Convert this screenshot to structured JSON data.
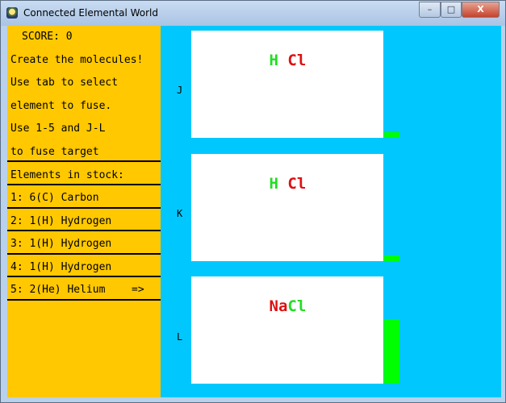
{
  "window": {
    "title": "Connected Elemental World",
    "controls": {
      "minimize": "–",
      "maximize": "□",
      "close": "X"
    }
  },
  "colors": {
    "game_bg": "#00c8ff",
    "sidebar_bg": "#ffc800",
    "progress": "#00ff00",
    "element_green": "#22dd22",
    "element_red": "#dd1111"
  },
  "sidebar": {
    "score": "SCORE: 0",
    "instructions": [
      "Create the molecules!",
      "Use tab to select",
      "element to fuse.",
      "Use 1-5 and J-L",
      "to fuse target"
    ],
    "stock_heading": "Elements in stock:",
    "stock": [
      {
        "label": "1: 6(C) Carbon"
      },
      {
        "label": "2: 1(H) Hydrogen"
      },
      {
        "label": "3: 1(H) Hydrogen"
      },
      {
        "label": "4: 1(H) Hydrogen"
      },
      {
        "label": "5: 2(He) Helium"
      }
    ],
    "selected_marker": "=>"
  },
  "targets": [
    {
      "key": "J",
      "elements": [
        {
          "symbol": "H",
          "color": "green"
        },
        {
          "symbol": " ",
          "color": "green"
        },
        {
          "symbol": "Cl",
          "color": "red"
        }
      ],
      "progress": 0.05
    },
    {
      "key": "K",
      "elements": [
        {
          "symbol": "H",
          "color": "green"
        },
        {
          "symbol": " ",
          "color": "green"
        },
        {
          "symbol": "Cl",
          "color": "red"
        }
      ],
      "progress": 0.05
    },
    {
      "key": "L",
      "elements": [
        {
          "symbol": "Na",
          "color": "red"
        },
        {
          "symbol": "Cl",
          "color": "green"
        }
      ],
      "progress": 0.6
    }
  ]
}
